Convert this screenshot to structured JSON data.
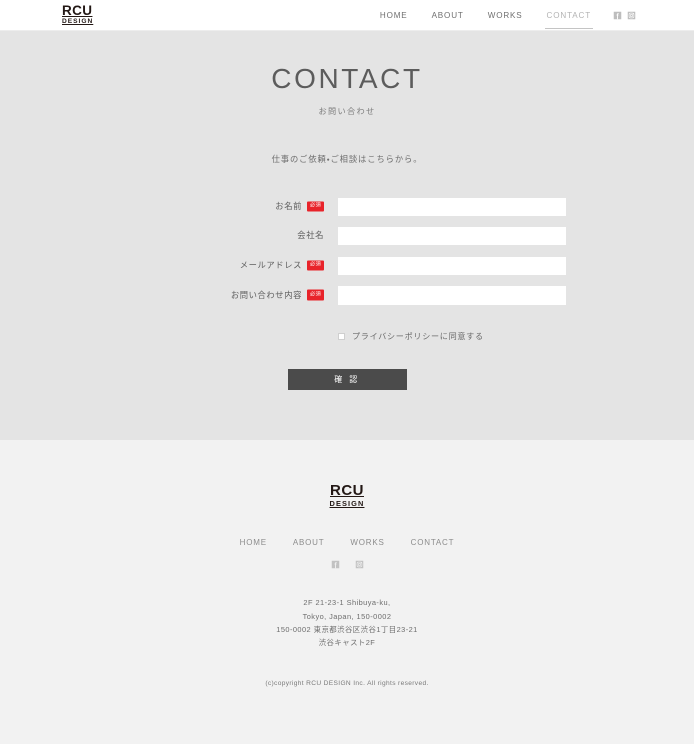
{
  "header": {
    "logo": {
      "main": "RCU",
      "sub": "DESIGN"
    },
    "nav": [
      {
        "label": "HOME",
        "active": false
      },
      {
        "label": "ABOUT",
        "active": false
      },
      {
        "label": "WORKS",
        "active": false
      },
      {
        "label": "CONTACT",
        "active": true
      }
    ],
    "socials": [
      {
        "name": "facebook-icon"
      },
      {
        "name": "instagram-icon"
      }
    ]
  },
  "main": {
    "title": "CONTACT",
    "subtitle": "お問い合わせ",
    "lead": "仕事のご依頼・ご相談はこちらから。",
    "form": {
      "fields": [
        {
          "label": "お名前",
          "required": true,
          "badge": "必須",
          "value": "",
          "placeholder": "",
          "type": "text"
        },
        {
          "label": "会社名",
          "required": false,
          "badge": "",
          "value": "",
          "placeholder": "",
          "type": "text"
        },
        {
          "label": "メールアドレス",
          "required": true,
          "badge": "必須",
          "value": "",
          "placeholder": "",
          "type": "email"
        },
        {
          "label": "お問い合わせ内容",
          "required": true,
          "badge": "必須",
          "value": "",
          "placeholder": "",
          "type": "textarea"
        }
      ],
      "agree_label": "プライバシーポリシーに同意する",
      "agree_checked": false,
      "submit_label": "確 認"
    }
  },
  "footer": {
    "logo": {
      "main": "RCU",
      "sub": "DESIGN"
    },
    "nav": [
      {
        "label": "HOME"
      },
      {
        "label": "ABOUT"
      },
      {
        "label": "WORKS"
      },
      {
        "label": "CONTACT"
      }
    ],
    "socials": [
      {
        "name": "facebook-icon"
      },
      {
        "name": "instagram-icon"
      }
    ],
    "address": [
      "2F 21-23-1 Shibuya-ku,",
      "Tokyo, Japan, 150-0002",
      "150-0002 東京都渋谷区渋谷1丁目23-21",
      "渋谷キャスト2F"
    ],
    "copyright": "(c)copyright RCU DESIGN Inc. All rights reserved."
  },
  "colors": {
    "header_bg": "#ffffff",
    "section_bg": "#e4e4e4",
    "footer_bg": "#f2f2f2",
    "required_badge": "#e8232a",
    "submit_bg": "#4b4b4b",
    "logo_color": "#231815"
  }
}
